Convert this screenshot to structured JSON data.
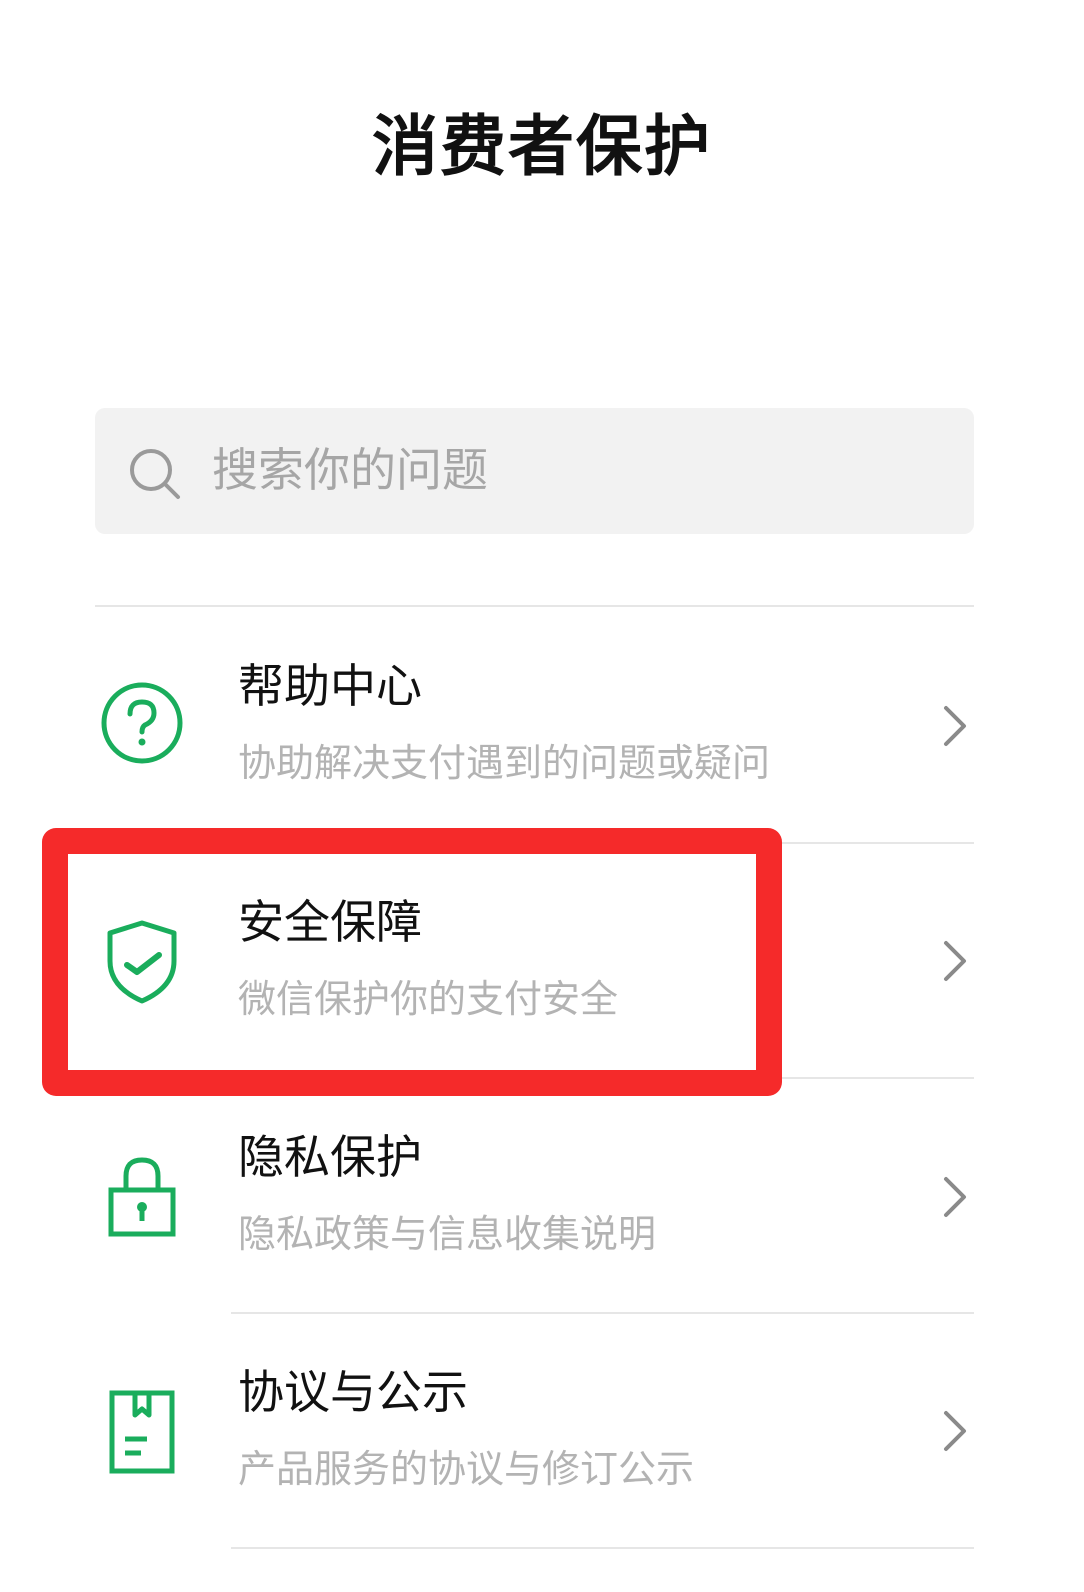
{
  "header": {
    "title": "消费者保护"
  },
  "search": {
    "placeholder": "搜索你的问题",
    "icon": "search-icon"
  },
  "items": [
    {
      "title": "帮助中心",
      "subtitle": "协助解决支付遇到的问题或疑问",
      "icon": "help-circle-icon"
    },
    {
      "title": "安全保障",
      "subtitle": "微信保护你的支付安全",
      "icon": "shield-check-icon"
    },
    {
      "title": "隐私保护",
      "subtitle": "隐私政策与信息收集说明",
      "icon": "lock-icon"
    },
    {
      "title": "协议与公示",
      "subtitle": "产品服务的协议与修订公示",
      "icon": "document-icon"
    }
  ],
  "colors": {
    "accent_green": "#1aad5c",
    "highlight_red": "#f52a2a",
    "title_text": "#111111",
    "subtitle_text": "#b3b3b3",
    "search_bg": "#f2f2f2"
  },
  "annotation": {
    "highlighted_item": "安全保障"
  }
}
